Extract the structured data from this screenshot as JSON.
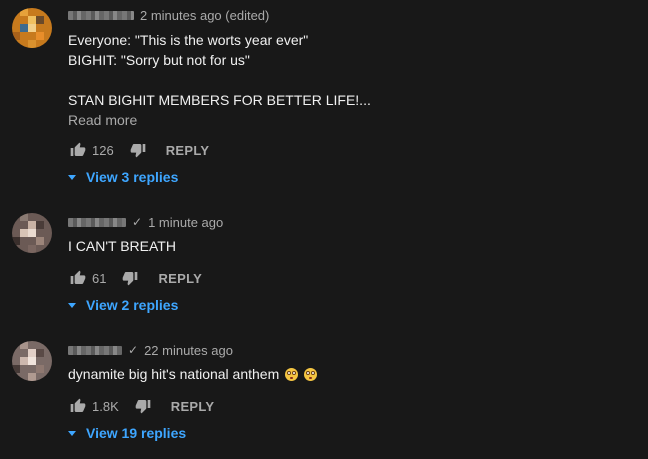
{
  "comments": [
    {
      "timestamp": "2 minutes ago (edited)",
      "text_lines": [
        "Everyone: \"This is the worts year ever\"",
        "BIGHIT: \"Sorry but not for us\"",
        "",
        "STAN BIGHIT MEMBERS FOR BETTER LIFE!..."
      ],
      "read_more": "Read more",
      "likes": "126",
      "reply_label": "REPLY",
      "replies_label": "View 3 replies"
    },
    {
      "timestamp": "1 minute ago",
      "text_lines": [
        "I CAN'T BREATH"
      ],
      "likes": "61",
      "reply_label": "REPLY",
      "replies_label": "View 2 replies"
    },
    {
      "timestamp": "22 minutes ago",
      "text_lines": [
        "dynamite big hit's national anthem"
      ],
      "emoji": [
        "flushed-face",
        "flushed-face"
      ],
      "likes": "1.8K",
      "reply_label": "REPLY",
      "replies_label": "View 19 replies"
    }
  ],
  "colors": {
    "background": "#181818",
    "text": "#f1f1f1",
    "secondary": "#aaaaaa",
    "link": "#3ea6ff"
  }
}
